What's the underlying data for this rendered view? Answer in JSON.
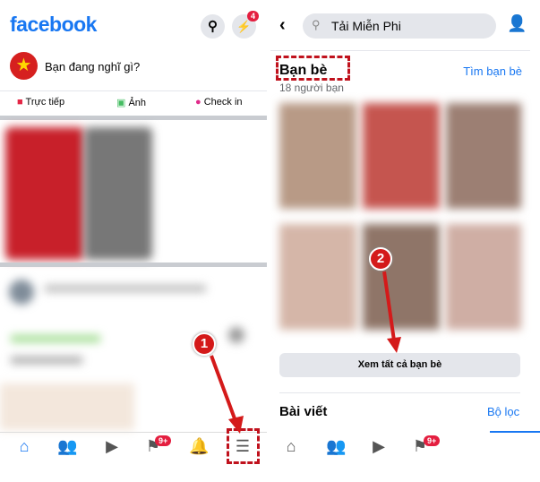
{
  "left": {
    "logo": "facebook",
    "messenger_badge": "4",
    "composer_placeholder": "Bạn đang nghĩ gì?",
    "actions": [
      {
        "label": "Trực tiếp",
        "icon": "live-video-icon",
        "color": "#e42645"
      },
      {
        "label": "Ảnh",
        "icon": "photo-icon",
        "color": "#45bd62"
      },
      {
        "label": "Check in",
        "icon": "location-pin-icon",
        "color": "#e02b8a"
      }
    ],
    "nav": {
      "home": "home-icon",
      "friends": "friends-icon",
      "watch": "watch-icon",
      "pages": "flag-icon",
      "pages_badge": "9+",
      "notifications": "bell-icon",
      "menu": "menu-icon"
    },
    "step": "1"
  },
  "right": {
    "search_value": "Tải Miễn Phi",
    "friends_title": "Bạn bè",
    "friends_count": "18 người bạn",
    "find_friends": "Tìm bạn bè",
    "see_all_friends": "Xem tất cả bạn bè",
    "posts_title": "Bài viết",
    "filter": "Bộ lọc",
    "pages_badge": "9+",
    "step": "2"
  },
  "colors": {
    "brand": "#1877f2",
    "annotation": "#c0121d"
  }
}
